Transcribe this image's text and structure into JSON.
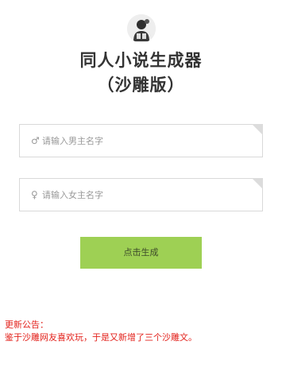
{
  "header": {
    "title_line1": "同人小说生成器",
    "title_line2": "（沙雕版）",
    "logo_icon": "avatar-portrait-icon"
  },
  "form": {
    "male": {
      "symbol": "♂",
      "placeholder": "请输入男主名字",
      "value": ""
    },
    "female": {
      "symbol": "♀",
      "placeholder": "请输入女主名字",
      "value": ""
    },
    "submit_label": "点击生成"
  },
  "notice": {
    "heading": "更新公告：",
    "body": "鉴于沙雕网友喜欢玩，于是又新增了三个沙雕文。"
  },
  "colors": {
    "button": "#9ed054",
    "notice": "#e3231d",
    "title": "#333333",
    "border": "#d9d9d9"
  }
}
